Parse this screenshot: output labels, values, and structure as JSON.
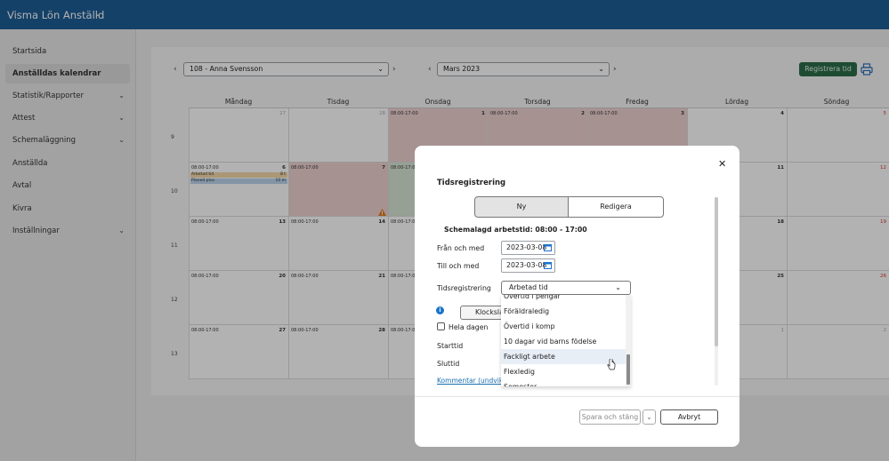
{
  "app": {
    "title": "Visma Lön Anställd"
  },
  "colors": {
    "topbar": "#1e5e96",
    "accent_button": "#2c6e49",
    "leave_day": "#efd2d2",
    "plan_day": "#d7e6d4",
    "link": "#1a6fb0"
  },
  "sidebar": {
    "items": [
      {
        "label": "Startsida",
        "has_chevron": false,
        "active": false
      },
      {
        "label": "Anställdas kalendrar",
        "has_chevron": false,
        "active": true
      },
      {
        "label": "Statistik/Rapporter",
        "has_chevron": true,
        "active": false
      },
      {
        "label": "Attest",
        "has_chevron": true,
        "active": false
      },
      {
        "label": "Schemaläggning",
        "has_chevron": true,
        "active": false
      },
      {
        "label": "Anställda",
        "has_chevron": false,
        "active": false
      },
      {
        "label": "Avtal",
        "has_chevron": false,
        "active": false
      },
      {
        "label": "Kivra",
        "has_chevron": false,
        "active": false
      },
      {
        "label": "Inställningar",
        "has_chevron": true,
        "active": false
      }
    ]
  },
  "toolbar": {
    "employee": "108 - Anna Svensson",
    "month": "Mars 2023",
    "register_label": "Registrera tid",
    "prev_icon": "chevron-left-icon",
    "next_icon": "chevron-right-icon",
    "print_icon": "printer-icon"
  },
  "calendar": {
    "days": [
      "Måndag",
      "Tisdag",
      "Onsdag",
      "Torsdag",
      "Fredag",
      "Lördag",
      "Söndag"
    ],
    "weeks": [
      {
        "week": "9",
        "cells": [
          {
            "num": "27",
            "muted": true
          },
          {
            "num": "28",
            "muted": true
          },
          {
            "num": "1",
            "time": "08:00-17:00",
            "shade": "red"
          },
          {
            "num": "2",
            "time": "08:00-17:00",
            "shade": "red"
          },
          {
            "num": "3",
            "time": "08:00-17:00",
            "shade": "red"
          },
          {
            "num": "4"
          },
          {
            "num": "5",
            "sunday": true
          }
        ]
      },
      {
        "week": "10",
        "cells": [
          {
            "num": "6",
            "time": "08:00-17:00",
            "bars": [
              {
                "label": "Arbetad tid",
                "value": "8 t",
                "color": "#f5d9a8"
              },
              {
                "label": "Planed plus",
                "value": "10 m",
                "color": "#bcd5ee"
              }
            ]
          },
          {
            "num": "7",
            "time": "08:00-17:00",
            "shade": "red"
          },
          {
            "num": "",
            "time": "08:00-17:00",
            "shade": "green"
          },
          {
            "num": "",
            "time": ""
          },
          {
            "num": "",
            "time": ""
          },
          {
            "num": "11"
          },
          {
            "num": "12",
            "sunday": true
          }
        ]
      },
      {
        "week": "11",
        "cells": [
          {
            "num": "13",
            "time": "08:00-17:00"
          },
          {
            "num": "14",
            "time": "08:00-17:00"
          },
          {
            "num": "",
            "time": "08:00-17:00"
          },
          {
            "num": ""
          },
          {
            "num": ""
          },
          {
            "num": "18"
          },
          {
            "num": "19",
            "sunday": true
          }
        ]
      },
      {
        "week": "12",
        "cells": [
          {
            "num": "20",
            "time": "08:00-17:00"
          },
          {
            "num": "21",
            "time": "08:00-17:00"
          },
          {
            "num": "",
            "time": "08:00-17:00"
          },
          {
            "num": ""
          },
          {
            "num": ""
          },
          {
            "num": "25"
          },
          {
            "num": "26",
            "sunday": true
          }
        ]
      },
      {
        "week": "13",
        "cells": [
          {
            "num": "27",
            "time": "08:00-17:00"
          },
          {
            "num": "28",
            "time": "08:00-17:00"
          },
          {
            "num": "",
            "time": "08:00-17:00"
          },
          {
            "num": ""
          },
          {
            "num": ""
          },
          {
            "num": "1",
            "muted": true
          },
          {
            "num": "2",
            "muted": true
          }
        ]
      }
    ]
  },
  "modal": {
    "title": "Tidsregistrering",
    "tab_new": "Ny",
    "tab_edit": "Redigera",
    "schedule": "Schemalagd arbetstid: 08:00 - 17:00",
    "from_label": "Från och med",
    "from_value": "2023-03-08",
    "to_label": "Till och med",
    "to_value": "2023-03-08",
    "type_label": "Tidsregistrering",
    "type_value": "Arbetad tid",
    "clock_label": "Klockslag",
    "allday_label": "Hela dagen",
    "start_label": "Starttid",
    "end_label": "Sluttid",
    "comment_link": "Kommentar (undvik att",
    "options": [
      "Övertid i pengar",
      "Föräldraledig",
      "Övertid i komp",
      "10 dagar vid barns födelse",
      "Fackligt arbete",
      "Flexledig",
      "Semester"
    ],
    "selected_option": "Fackligt arbete",
    "save_label": "Spara och stäng",
    "cancel_label": "Avbryt",
    "close_icon": "close-icon"
  }
}
